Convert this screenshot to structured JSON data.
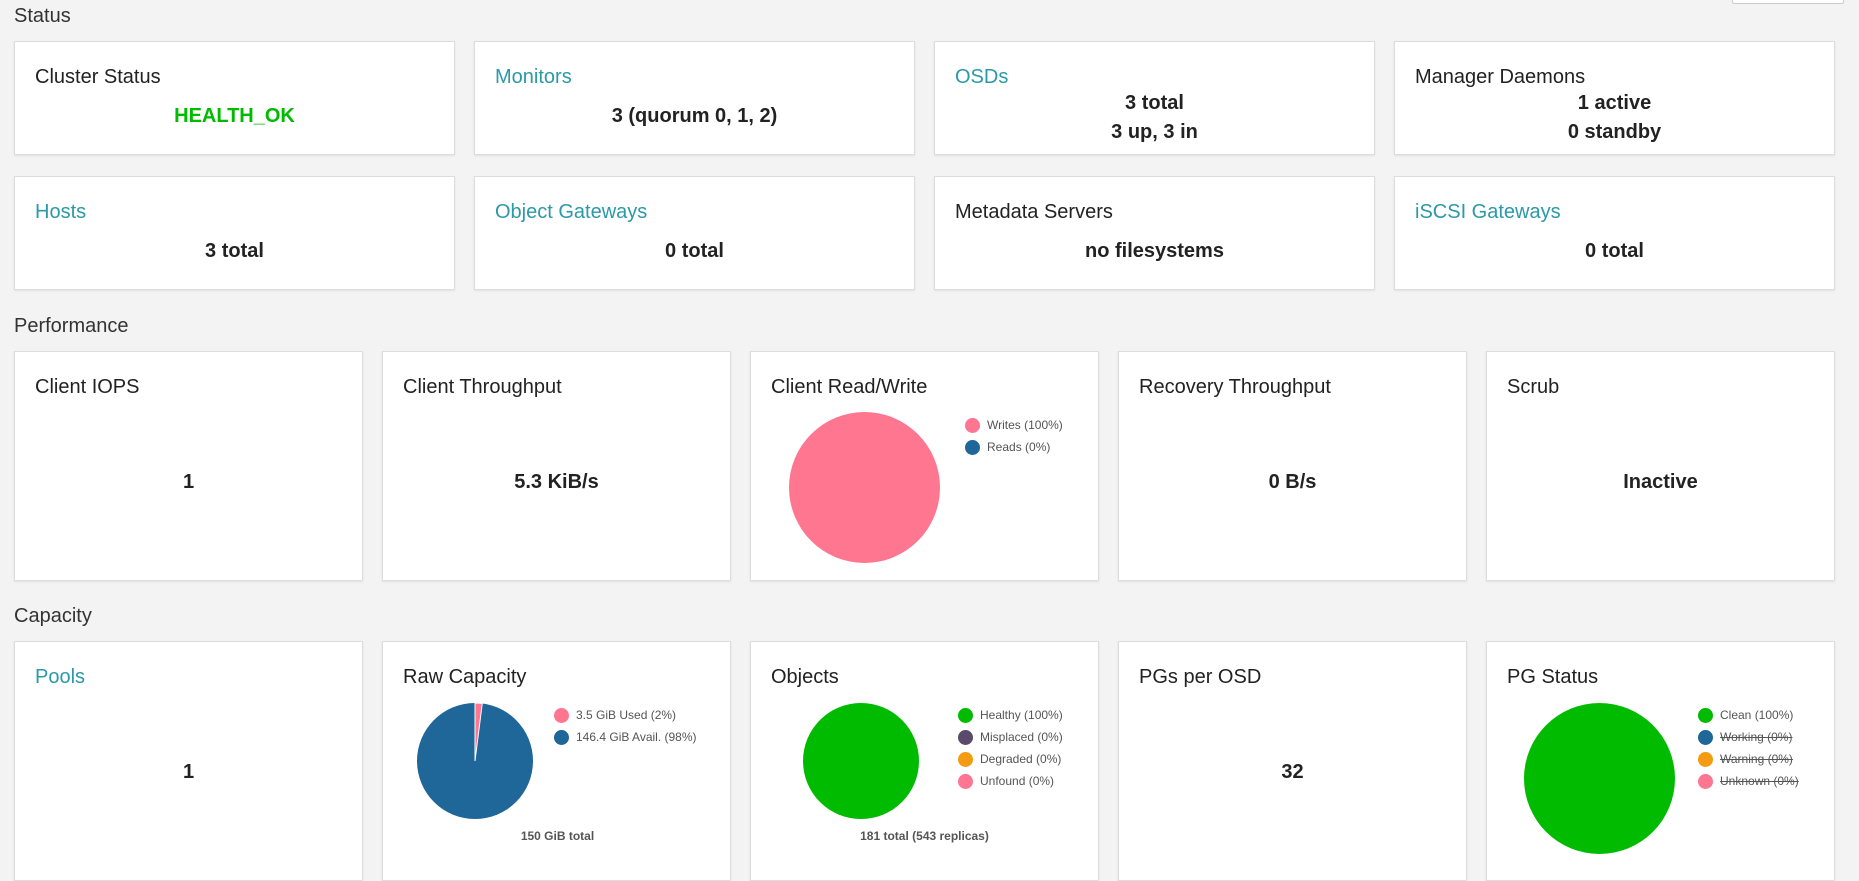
{
  "sections": {
    "status": "Status",
    "performance": "Performance",
    "capacity": "Capacity"
  },
  "colors": {
    "link": "#2b99a8",
    "health_ok": "#00bb00",
    "pink": "#ff7691",
    "blue": "#1f6699",
    "green": "#00bb00",
    "purple": "#5a4b6d",
    "orange": "#f39c12"
  },
  "status": {
    "cluster": {
      "title": "Cluster Status",
      "value": "HEALTH_OK"
    },
    "monitors": {
      "title": "Monitors",
      "value": "3 (quorum 0, 1, 2)"
    },
    "osds": {
      "title": "OSDs",
      "line1": "3 total",
      "line2": "3 up, 3 in"
    },
    "managers": {
      "title": "Manager Daemons",
      "line1": "1 active",
      "line2": "0 standby"
    },
    "hosts": {
      "title": "Hosts",
      "value": "3 total"
    },
    "object_gateways": {
      "title": "Object Gateways",
      "value": "0 total"
    },
    "metadata_servers": {
      "title": "Metadata Servers",
      "value": "no filesystems"
    },
    "iscsi": {
      "title": "iSCSI Gateways",
      "value": "0 total"
    }
  },
  "performance": {
    "iops": {
      "title": "Client IOPS",
      "value": "1"
    },
    "throughput": {
      "title": "Client Throughput",
      "value": "5.3 KiB/s"
    },
    "readwrite": {
      "title": "Client Read/Write",
      "legend": [
        "Writes (100%)",
        "Reads (0%)"
      ],
      "fractions": [
        1.0,
        0.0
      ]
    },
    "recovery": {
      "title": "Recovery Throughput",
      "value": "0 B/s"
    },
    "scrub": {
      "title": "Scrub",
      "value": "Inactive"
    }
  },
  "capacity": {
    "pools": {
      "title": "Pools",
      "value": "1"
    },
    "raw": {
      "title": "Raw Capacity",
      "legend": [
        "3.5 GiB Used (2%)",
        "146.4 GiB Avail. (98%)"
      ],
      "fractions": [
        0.02,
        0.98
      ],
      "caption": "150 GiB total"
    },
    "objects": {
      "title": "Objects",
      "legend": [
        "Healthy (100%)",
        "Misplaced (0%)",
        "Degraded (0%)",
        "Unfound (0%)"
      ],
      "fractions": [
        1.0,
        0,
        0,
        0
      ],
      "caption": "181 total (543 replicas)"
    },
    "pgs_per_osd": {
      "title": "PGs per OSD",
      "value": "32"
    },
    "pg_status": {
      "title": "PG Status",
      "legend": [
        "Clean (100%)",
        "Working (0%)",
        "Warning (0%)",
        "Unknown (0%)"
      ],
      "fractions": [
        1.0,
        0,
        0,
        0
      ]
    }
  }
}
